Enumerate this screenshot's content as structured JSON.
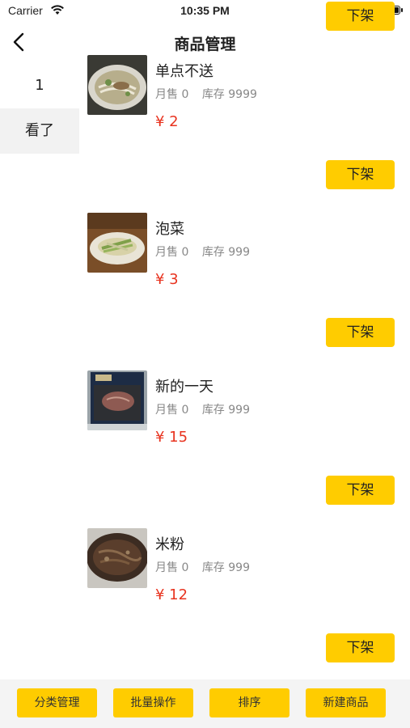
{
  "status_bar": {
    "carrier": "Carrier",
    "time": "10:35 PM"
  },
  "nav": {
    "title": "商品管理"
  },
  "sidebar": {
    "items": [
      {
        "label": "1",
        "selected": true
      },
      {
        "label": "看了",
        "selected": false
      }
    ]
  },
  "products": [
    {
      "name": "单点不送",
      "sales": "月售 0",
      "stock": "库存 9999",
      "price": "¥ 2",
      "button": "下架",
      "image": "noodle-soup-photo"
    },
    {
      "name": "泡菜",
      "sales": "月售 0",
      "stock": "库存 999",
      "price": "¥ 3",
      "button": "下架",
      "image": "pickles-plate-photo"
    },
    {
      "name": "新的一天",
      "sales": "月售 0",
      "stock": "库存 999",
      "price": "¥ 15",
      "button": "下架",
      "image": "packaged-meat-photo"
    },
    {
      "name": "米粉",
      "sales": "月售 0",
      "stock": "库存 999",
      "price": "¥ 12",
      "button": "下架",
      "image": "rice-noodle-pan-photo"
    }
  ],
  "extra_button": "下架",
  "bottom_bar": {
    "buttons": [
      "分类管理",
      "批量操作",
      "排序",
      "新建商品"
    ]
  },
  "colors": {
    "accent": "#ffcc00",
    "price": "#e8331f",
    "sidebar_bg": "#f2f2f2"
  }
}
